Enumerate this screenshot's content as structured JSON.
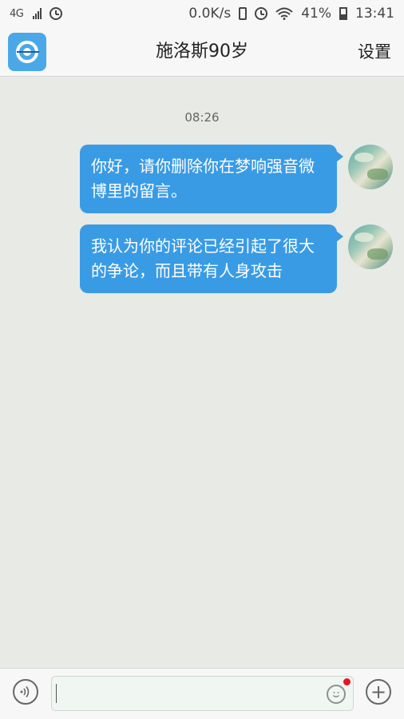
{
  "status_bar": {
    "network": "4G",
    "speed": "0.0K/s",
    "battery": "41%",
    "time": "13:41"
  },
  "header": {
    "title": "施洛斯90岁",
    "settings_label": "设置"
  },
  "chat": {
    "timestamp": "08:26",
    "messages": [
      {
        "text": "你好，请你删除你在梦响强音微博里的留言。"
      },
      {
        "text": "我认为你的评论已经引起了很大的争论，而且带有人身攻击"
      }
    ]
  },
  "input_bar": {
    "value": "",
    "voice_icon": "voice-icon",
    "emoji_icon": "emoji-icon",
    "plus_icon": "plus-icon"
  },
  "colors": {
    "bubble": "#3a9be5",
    "background": "#e8eae6"
  }
}
